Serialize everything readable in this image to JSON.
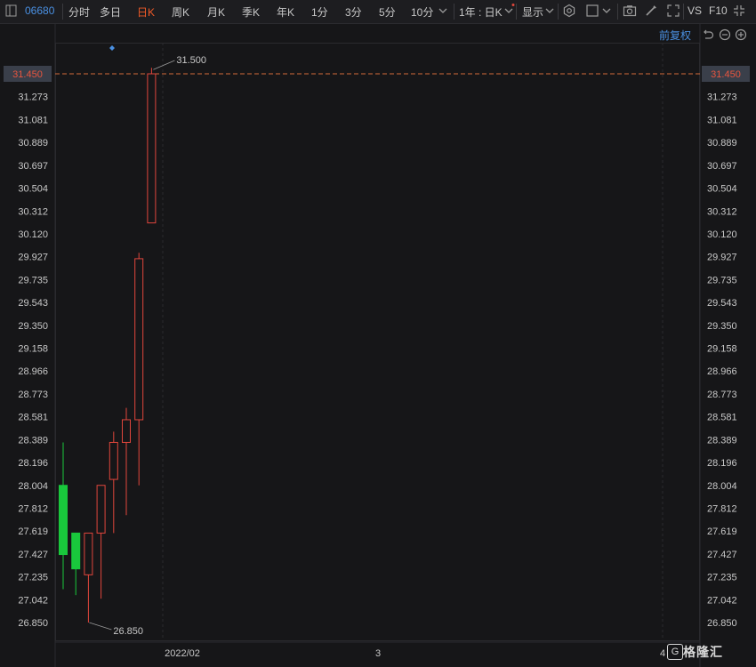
{
  "toolbar": {
    "code": "06680",
    "tabs": [
      "分时",
      "多日",
      "日K",
      "周K",
      "月K",
      "季K",
      "年K",
      "1分",
      "3分",
      "5分",
      "10分"
    ],
    "active_tab": "日K",
    "period_select": "1年 : 日K",
    "display_label": "显示",
    "vs_label": "VS",
    "f10_label": "F10",
    "adjust_label": "前复权"
  },
  "colors": {
    "up": "#e0463c",
    "down": "#19c83c",
    "axis_text": "#c8c8c8",
    "price_line": "#d46a3a",
    "price_tag_bg": "#3a3f4a",
    "price_tag_text": "#e8553f",
    "blue": "#4a90e2"
  },
  "chart_data": {
    "type": "candlestick",
    "y_ticks": [
      "31.450",
      "31.273",
      "31.081",
      "30.889",
      "30.697",
      "30.504",
      "30.312",
      "30.120",
      "29.927",
      "29.735",
      "29.543",
      "29.350",
      "29.158",
      "28.966",
      "28.773",
      "28.581",
      "28.389",
      "28.196",
      "28.004",
      "27.812",
      "27.619",
      "27.427",
      "27.235",
      "27.042",
      "26.850"
    ],
    "ylim": [
      26.85,
      31.45
    ],
    "x_labels": [
      "2022/02",
      "3",
      "4"
    ],
    "current_price": "31.450",
    "max_label": "31.500",
    "min_label": "26.850",
    "candles": [
      {
        "open": 28.0,
        "high": 28.36,
        "low": 27.13,
        "close": 27.42
      },
      {
        "open": 27.6,
        "high": 27.6,
        "low": 27.08,
        "close": 27.3
      },
      {
        "open": 27.25,
        "high": 27.6,
        "low": 26.85,
        "close": 27.6
      },
      {
        "open": 27.6,
        "high": 28.0,
        "low": 27.05,
        "close": 28.0
      },
      {
        "open": 28.05,
        "high": 28.45,
        "low": 27.6,
        "close": 28.36
      },
      {
        "open": 28.36,
        "high": 28.65,
        "low": 27.75,
        "close": 28.55
      },
      {
        "open": 28.55,
        "high": 29.95,
        "low": 28.0,
        "close": 29.9
      },
      {
        "open": 30.2,
        "high": 31.5,
        "low": 30.2,
        "close": 31.45
      }
    ]
  }
}
